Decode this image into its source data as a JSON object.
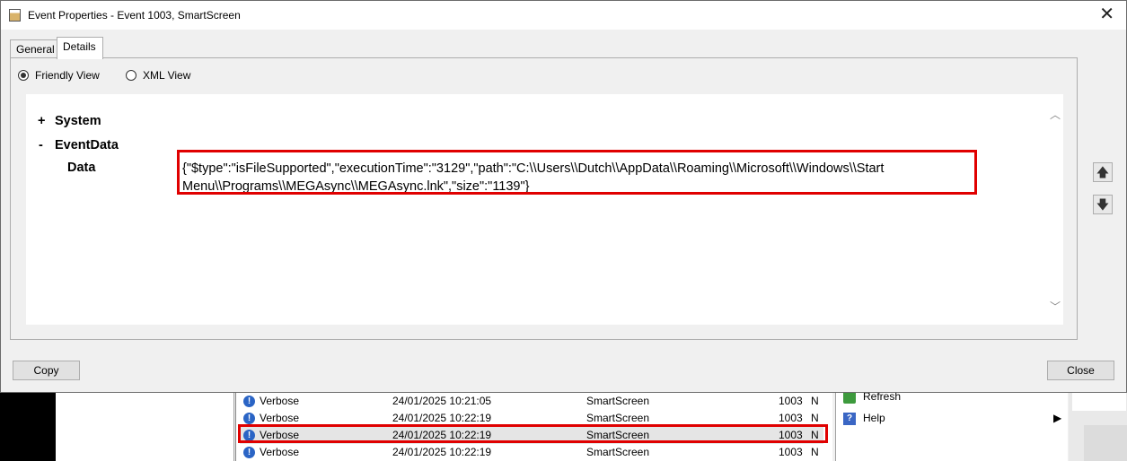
{
  "dialog": {
    "title": "Event Properties - Event 1003, SmartScreen",
    "close_glyph": "✕",
    "tabs": [
      {
        "label": "General"
      },
      {
        "label": "Details"
      }
    ],
    "view_options": {
      "friendly_label": "Friendly View",
      "xml_label": "XML View",
      "selected": "Friendly View"
    },
    "tree": {
      "system_expander": "+",
      "system_label": "System",
      "eventdata_expander": "-",
      "eventdata_label": "EventData",
      "data_label": "Data",
      "data_value": "{\"$type\":\"isFileSupported\",\"executionTime\":\"3129\",\"path\":\"C:\\\\Users\\\\Dutch\\\\AppData\\\\Roaming\\\\Microsoft\\\\Windows\\\\Start Menu\\\\Programs\\\\MEGAsync\\\\MEGAsync.lnk\",\"size\":\"1139\"}"
    },
    "buttons": {
      "copy": "Copy",
      "close": "Close"
    },
    "icons": {
      "scroll_up": "chevron-up-icon",
      "scroll_down": "chevron-down-icon",
      "prev_event": "arrow-up-icon",
      "next_event": "arrow-down-icon"
    }
  },
  "event_list": {
    "rows": [
      {
        "level": "Verbose",
        "datetime": "24/01/2025 10:21:05",
        "source": "SmartScreen",
        "event_id": "1003",
        "task": "N"
      },
      {
        "level": "Verbose",
        "datetime": "24/01/2025 10:22:19",
        "source": "SmartScreen",
        "event_id": "1003",
        "task": "N"
      },
      {
        "level": "Verbose",
        "datetime": "24/01/2025 10:22:19",
        "source": "SmartScreen",
        "event_id": "1003",
        "task": "N"
      },
      {
        "level": "Verbose",
        "datetime": "24/01/2025 10:22:19",
        "source": "SmartScreen",
        "event_id": "1003",
        "task": "N"
      }
    ]
  },
  "actions": {
    "items": [
      {
        "label": "Refresh",
        "icon": "refresh-icon"
      },
      {
        "label": "Help",
        "icon": "help-icon"
      }
    ]
  },
  "colors": {
    "highlight": "#e00000",
    "info_icon": "#2a64c5"
  }
}
